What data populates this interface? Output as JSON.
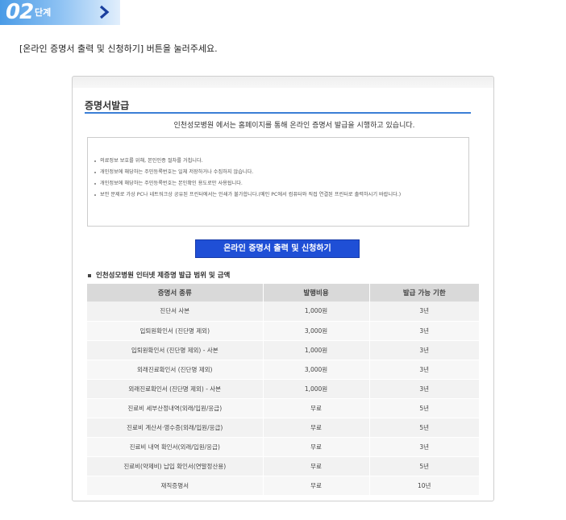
{
  "step": {
    "number": "02",
    "word": "단계"
  },
  "instruction": "[온라인 증명서 출력 및 신청하기] 버튼을 눌러주세요.",
  "panel": {
    "title": "증명서발급",
    "intro": "인천성모병원 에서는 홈페이지를 통해 온라인 증명서 발급을 시행하고 있습니다."
  },
  "notices": [
    "의료정보 보호를 위해, 본인인증 절차를 거칩니다.",
    "개인정보에 해당하는 주민등록번호는 일체 저장하거나 수집하지 않습니다.",
    "개인정보에 해당하는 주민등록번호는 본인확인 용도로만 사용됩니다.",
    "보안 문제로 가상 PC나 네트워크상 공유된 프린터에서는 인쇄가 불가합니다.(메인 PC에서 컴퓨터와 직접 연결된 프린터로 출력하시기 바랍니다.)"
  ],
  "online_button": "온라인 증명서 출력 및 신청하기",
  "fee_section_title": "인천성모병원 인터넷 제증명 발급 범위 및 금액",
  "fee_table": {
    "headers": [
      "증명서 종류",
      "발행비용",
      "발급 가능 기한"
    ],
    "rows": [
      [
        "진단서 사본",
        "1,000원",
        "3년"
      ],
      [
        "입퇴원확인서 (진단명 제외)",
        "3,000원",
        "3년"
      ],
      [
        "입퇴원확인서 (진단명 제외) - 사본",
        "1,000원",
        "3년"
      ],
      [
        "외래진료확인서 (진단명 제외)",
        "3,000원",
        "3년"
      ],
      [
        "외래진료확인서 (진단명 제외) - 사본",
        "1,000원",
        "3년"
      ],
      [
        "진료비 세부산정내역(외래/입원/응급)",
        "무료",
        "5년"
      ],
      [
        "진료비 계산서·영수증(외래/입원/응급)",
        "무료",
        "5년"
      ],
      [
        "진료비 내역 확인서(외래/입원/응급)",
        "무료",
        "3년"
      ],
      [
        "진료비(약제비) 납입 확인서(연말정산용)",
        "무료",
        "5년"
      ],
      [
        "재직증명서",
        "무료",
        "10년"
      ]
    ]
  },
  "colors": {
    "accent_blue": "#1f4fd6",
    "title_line": "#3b7fd6",
    "banner_start": "#4a9be6"
  },
  "icons": {
    "step_arrow": "chevron-right-icon"
  }
}
